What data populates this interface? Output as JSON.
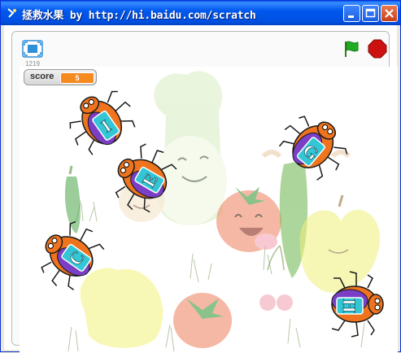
{
  "window": {
    "title": "拯救水果 by http://hi.baidu.com/scratch",
    "minimize_icon": "minimize-icon",
    "maximize_icon": "maximize-icon",
    "close_icon": "close-icon"
  },
  "toolbar": {
    "fullscreen_icon": "fullscreen-icon",
    "frame_number": "1219",
    "green_flag_icon": "green-flag-icon",
    "stop_icon": "stop-icon"
  },
  "stage": {
    "score_label": "score",
    "score_value": "5",
    "bugs": [
      {
        "letter": "I"
      },
      {
        "letter": "G"
      },
      {
        "letter": "E"
      },
      {
        "letter": "C"
      },
      {
        "letter": "H"
      }
    ]
  },
  "colors": {
    "titlebar": "#0058ee",
    "score_bar": "#f58a1f",
    "flag": "#22aa22",
    "stop": "#cc1111",
    "bug_body": "#f0741e",
    "bug_shell": "#7a3fc4",
    "bug_tile": "#33c7d6"
  }
}
